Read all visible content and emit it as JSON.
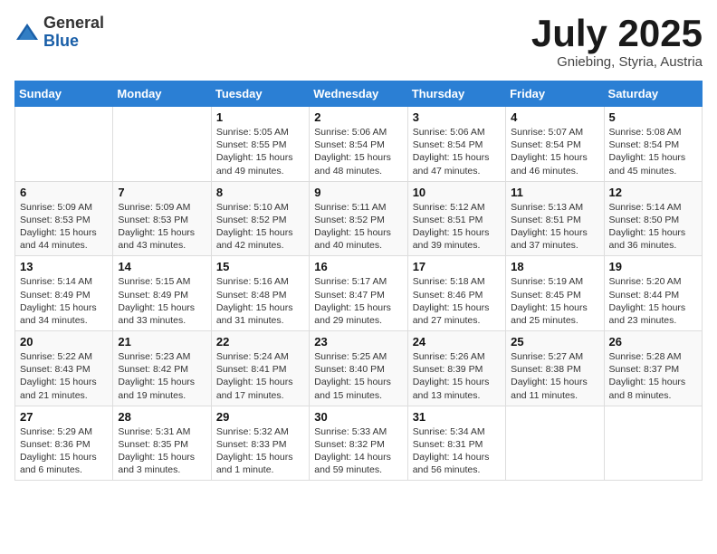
{
  "header": {
    "logo_general": "General",
    "logo_blue": "Blue",
    "month_title": "July 2025",
    "location": "Gniebing, Styria, Austria"
  },
  "calendar": {
    "headers": [
      "Sunday",
      "Monday",
      "Tuesday",
      "Wednesday",
      "Thursday",
      "Friday",
      "Saturday"
    ],
    "weeks": [
      [
        {
          "day": "",
          "info": ""
        },
        {
          "day": "",
          "info": ""
        },
        {
          "day": "1",
          "info": "Sunrise: 5:05 AM\nSunset: 8:55 PM\nDaylight: 15 hours\nand 49 minutes."
        },
        {
          "day": "2",
          "info": "Sunrise: 5:06 AM\nSunset: 8:54 PM\nDaylight: 15 hours\nand 48 minutes."
        },
        {
          "day": "3",
          "info": "Sunrise: 5:06 AM\nSunset: 8:54 PM\nDaylight: 15 hours\nand 47 minutes."
        },
        {
          "day": "4",
          "info": "Sunrise: 5:07 AM\nSunset: 8:54 PM\nDaylight: 15 hours\nand 46 minutes."
        },
        {
          "day": "5",
          "info": "Sunrise: 5:08 AM\nSunset: 8:54 PM\nDaylight: 15 hours\nand 45 minutes."
        }
      ],
      [
        {
          "day": "6",
          "info": "Sunrise: 5:09 AM\nSunset: 8:53 PM\nDaylight: 15 hours\nand 44 minutes."
        },
        {
          "day": "7",
          "info": "Sunrise: 5:09 AM\nSunset: 8:53 PM\nDaylight: 15 hours\nand 43 minutes."
        },
        {
          "day": "8",
          "info": "Sunrise: 5:10 AM\nSunset: 8:52 PM\nDaylight: 15 hours\nand 42 minutes."
        },
        {
          "day": "9",
          "info": "Sunrise: 5:11 AM\nSunset: 8:52 PM\nDaylight: 15 hours\nand 40 minutes."
        },
        {
          "day": "10",
          "info": "Sunrise: 5:12 AM\nSunset: 8:51 PM\nDaylight: 15 hours\nand 39 minutes."
        },
        {
          "day": "11",
          "info": "Sunrise: 5:13 AM\nSunset: 8:51 PM\nDaylight: 15 hours\nand 37 minutes."
        },
        {
          "day": "12",
          "info": "Sunrise: 5:14 AM\nSunset: 8:50 PM\nDaylight: 15 hours\nand 36 minutes."
        }
      ],
      [
        {
          "day": "13",
          "info": "Sunrise: 5:14 AM\nSunset: 8:49 PM\nDaylight: 15 hours\nand 34 minutes."
        },
        {
          "day": "14",
          "info": "Sunrise: 5:15 AM\nSunset: 8:49 PM\nDaylight: 15 hours\nand 33 minutes."
        },
        {
          "day": "15",
          "info": "Sunrise: 5:16 AM\nSunset: 8:48 PM\nDaylight: 15 hours\nand 31 minutes."
        },
        {
          "day": "16",
          "info": "Sunrise: 5:17 AM\nSunset: 8:47 PM\nDaylight: 15 hours\nand 29 minutes."
        },
        {
          "day": "17",
          "info": "Sunrise: 5:18 AM\nSunset: 8:46 PM\nDaylight: 15 hours\nand 27 minutes."
        },
        {
          "day": "18",
          "info": "Sunrise: 5:19 AM\nSunset: 8:45 PM\nDaylight: 15 hours\nand 25 minutes."
        },
        {
          "day": "19",
          "info": "Sunrise: 5:20 AM\nSunset: 8:44 PM\nDaylight: 15 hours\nand 23 minutes."
        }
      ],
      [
        {
          "day": "20",
          "info": "Sunrise: 5:22 AM\nSunset: 8:43 PM\nDaylight: 15 hours\nand 21 minutes."
        },
        {
          "day": "21",
          "info": "Sunrise: 5:23 AM\nSunset: 8:42 PM\nDaylight: 15 hours\nand 19 minutes."
        },
        {
          "day": "22",
          "info": "Sunrise: 5:24 AM\nSunset: 8:41 PM\nDaylight: 15 hours\nand 17 minutes."
        },
        {
          "day": "23",
          "info": "Sunrise: 5:25 AM\nSunset: 8:40 PM\nDaylight: 15 hours\nand 15 minutes."
        },
        {
          "day": "24",
          "info": "Sunrise: 5:26 AM\nSunset: 8:39 PM\nDaylight: 15 hours\nand 13 minutes."
        },
        {
          "day": "25",
          "info": "Sunrise: 5:27 AM\nSunset: 8:38 PM\nDaylight: 15 hours\nand 11 minutes."
        },
        {
          "day": "26",
          "info": "Sunrise: 5:28 AM\nSunset: 8:37 PM\nDaylight: 15 hours\nand 8 minutes."
        }
      ],
      [
        {
          "day": "27",
          "info": "Sunrise: 5:29 AM\nSunset: 8:36 PM\nDaylight: 15 hours\nand 6 minutes."
        },
        {
          "day": "28",
          "info": "Sunrise: 5:31 AM\nSunset: 8:35 PM\nDaylight: 15 hours\nand 3 minutes."
        },
        {
          "day": "29",
          "info": "Sunrise: 5:32 AM\nSunset: 8:33 PM\nDaylight: 15 hours\nand 1 minute."
        },
        {
          "day": "30",
          "info": "Sunrise: 5:33 AM\nSunset: 8:32 PM\nDaylight: 14 hours\nand 59 minutes."
        },
        {
          "day": "31",
          "info": "Sunrise: 5:34 AM\nSunset: 8:31 PM\nDaylight: 14 hours\nand 56 minutes."
        },
        {
          "day": "",
          "info": ""
        },
        {
          "day": "",
          "info": ""
        }
      ]
    ]
  }
}
